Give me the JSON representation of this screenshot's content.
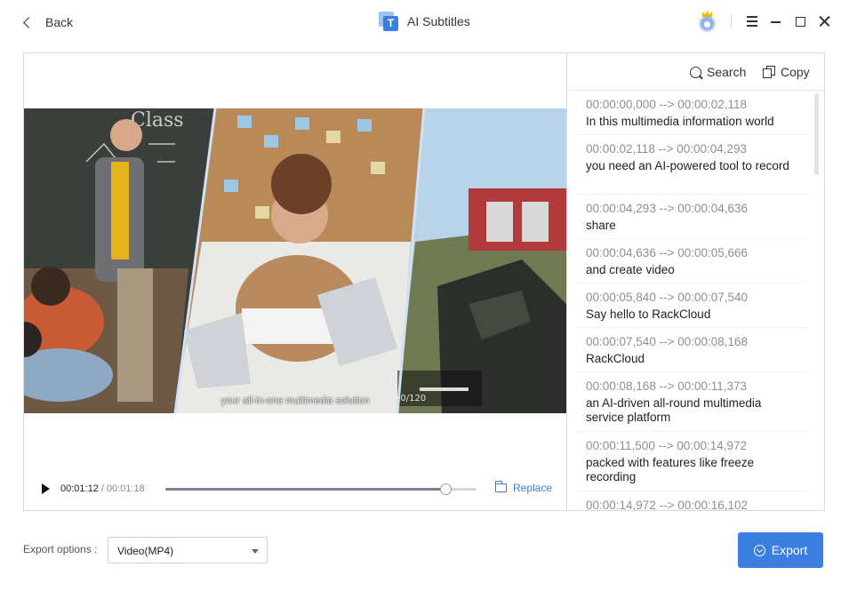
{
  "titlebar": {
    "back_label": "Back",
    "app_title": "AI Subtitles"
  },
  "player": {
    "caption": "your all-in-one multimedia solution",
    "current_time": "00:01:12",
    "separator": "/",
    "total_time": "00:01:18",
    "progress": 0.9,
    "replace_label": "Replace"
  },
  "subtitles": {
    "search_label": "Search",
    "copy_label": "Copy",
    "entries": [
      {
        "time": "00:00:00,000 --> 00:00:02,118",
        "text": "In this multimedia information world"
      },
      {
        "time": "00:00:02,118 --> 00:00:04,293",
        "text": "you need an AI-powered tool to record"
      },
      {
        "time": "00:00:04,293 --> 00:00:04,636",
        "text": "share"
      },
      {
        "time": "00:00:04,636 --> 00:00:05,666",
        "text": "and create video"
      },
      {
        "time": "00:00:05,840 --> 00:00:07,540",
        "text": "Say hello to RackCloud"
      },
      {
        "time": "00:00:07,540 --> 00:00:08,168",
        "text": "RackCloud"
      },
      {
        "time": "00:00:08,168 --> 00:00:11,373",
        "text": "an AI-driven all-round multimedia service platform"
      },
      {
        "time": "00:00:11,500 --> 00:00:14,972",
        "text": "packed with features like freeze recording"
      },
      {
        "time": "00:00:14,972 --> 00:00:16,102",
        "text": ""
      }
    ]
  },
  "footer": {
    "export_options_label": "Export options :",
    "export_format": "Video(MP4)",
    "export_button": "Export"
  },
  "colors": {
    "accent": "#3a7fe0",
    "border": "#dcdcdc"
  }
}
